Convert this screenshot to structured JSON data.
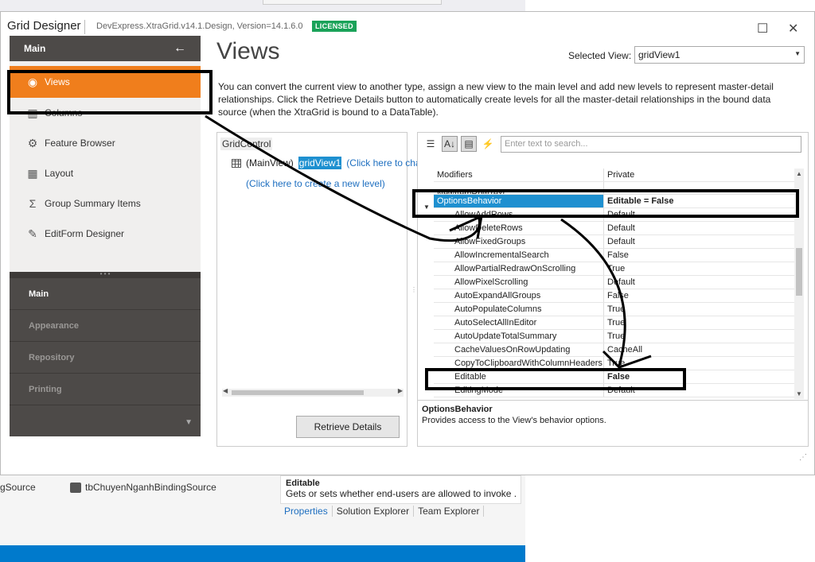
{
  "background": {
    "sources": [
      "gSource",
      "tbChuyenNganhBindingSource"
    ],
    "help_title": "Editable",
    "help_text": "Gets or sets whether end-users are allowed to invoke ...",
    "tabs": [
      "Properties",
      "Solution Explorer",
      "Team Explorer"
    ]
  },
  "dialog": {
    "title": "Grid Designer",
    "version": "DevExpress.XtraGrid.v14.1.Design, Version=14.1.6.0",
    "badge": "LICENSED",
    "maximize": "☐",
    "close": "✕"
  },
  "nav": {
    "header": "Main",
    "back_icon": "←",
    "items": [
      {
        "label": "Views",
        "icon": "eye-icon",
        "glyph": "◉"
      },
      {
        "label": "Columns",
        "icon": "columns-icon",
        "glyph": "▥"
      },
      {
        "label": "Feature Browser",
        "icon": "gear-icon",
        "glyph": "⚙"
      },
      {
        "label": "Layout",
        "icon": "layout-icon",
        "glyph": "▦"
      },
      {
        "label": "Group Summary Items",
        "icon": "sigma-icon",
        "glyph": "Σ"
      },
      {
        "label": "EditForm Designer",
        "icon": "edit-form-icon",
        "glyph": "✎"
      }
    ],
    "groups": [
      "Main",
      "Appearance",
      "Repository",
      "Printing"
    ]
  },
  "main": {
    "title": "Views",
    "selected_view_label": "Selected View:",
    "selected_view_value": "gridView1",
    "description": "You can convert the current view to another type, assign a new view to the main level and add new levels to represent master-detail relationships. Click the Retrieve Details button to automatically create levels for all the master-detail relationships in the bound data source (when the XtraGrid is bound to a DataTable)."
  },
  "tree": {
    "root": "GridControl",
    "main_view_label": "(MainView)",
    "main_view_value": "gridView1",
    "change_link": "(Click here to cha",
    "new_level_link": "(Click here to create a new level)",
    "retrieve_button": "Retrieve Details"
  },
  "props": {
    "search_placeholder": "Enter text to search...",
    "toolbar": [
      "categorized-icon",
      "alphabetical-icon",
      "property-pages-icon",
      "events-icon"
    ],
    "rows": [
      {
        "name": "Modifiers",
        "value": "Private",
        "kind": "top"
      },
      {
        "name": "NewItemRowText",
        "value": "",
        "kind": "top"
      },
      {
        "name": "OptionsBehavior",
        "value": "Editable = False",
        "kind": "group"
      },
      {
        "name": "AllowAddRows",
        "value": "Default"
      },
      {
        "name": "AllowDeleteRows",
        "value": "Default"
      },
      {
        "name": "AllowFixedGroups",
        "value": "Default"
      },
      {
        "name": "AllowIncrementalSearch",
        "value": "False"
      },
      {
        "name": "AllowPartialRedrawOnScrolling",
        "value": "True"
      },
      {
        "name": "AllowPixelScrolling",
        "value": "Default"
      },
      {
        "name": "AutoExpandAllGroups",
        "value": "False"
      },
      {
        "name": "AutoPopulateColumns",
        "value": "True"
      },
      {
        "name": "AutoSelectAllInEditor",
        "value": "True"
      },
      {
        "name": "AutoUpdateTotalSummary",
        "value": "True"
      },
      {
        "name": "CacheValuesOnRowUpdating",
        "value": "CacheAll"
      },
      {
        "name": "CopyToClipboardWithColumnHeaders",
        "value": "True"
      },
      {
        "name": "Editable",
        "value": "False",
        "kind": "bold"
      },
      {
        "name": "EditingMode",
        "value": "Default"
      }
    ],
    "desc_title": "OptionsBehavior",
    "desc_text": "Provides access to the View's behavior options."
  },
  "colors": {
    "accent": "#f07e1c",
    "nav_dark": "#4d4a48",
    "selection": "#1e90d0",
    "badge": "#1aa259",
    "status_bar": "#007acc"
  }
}
